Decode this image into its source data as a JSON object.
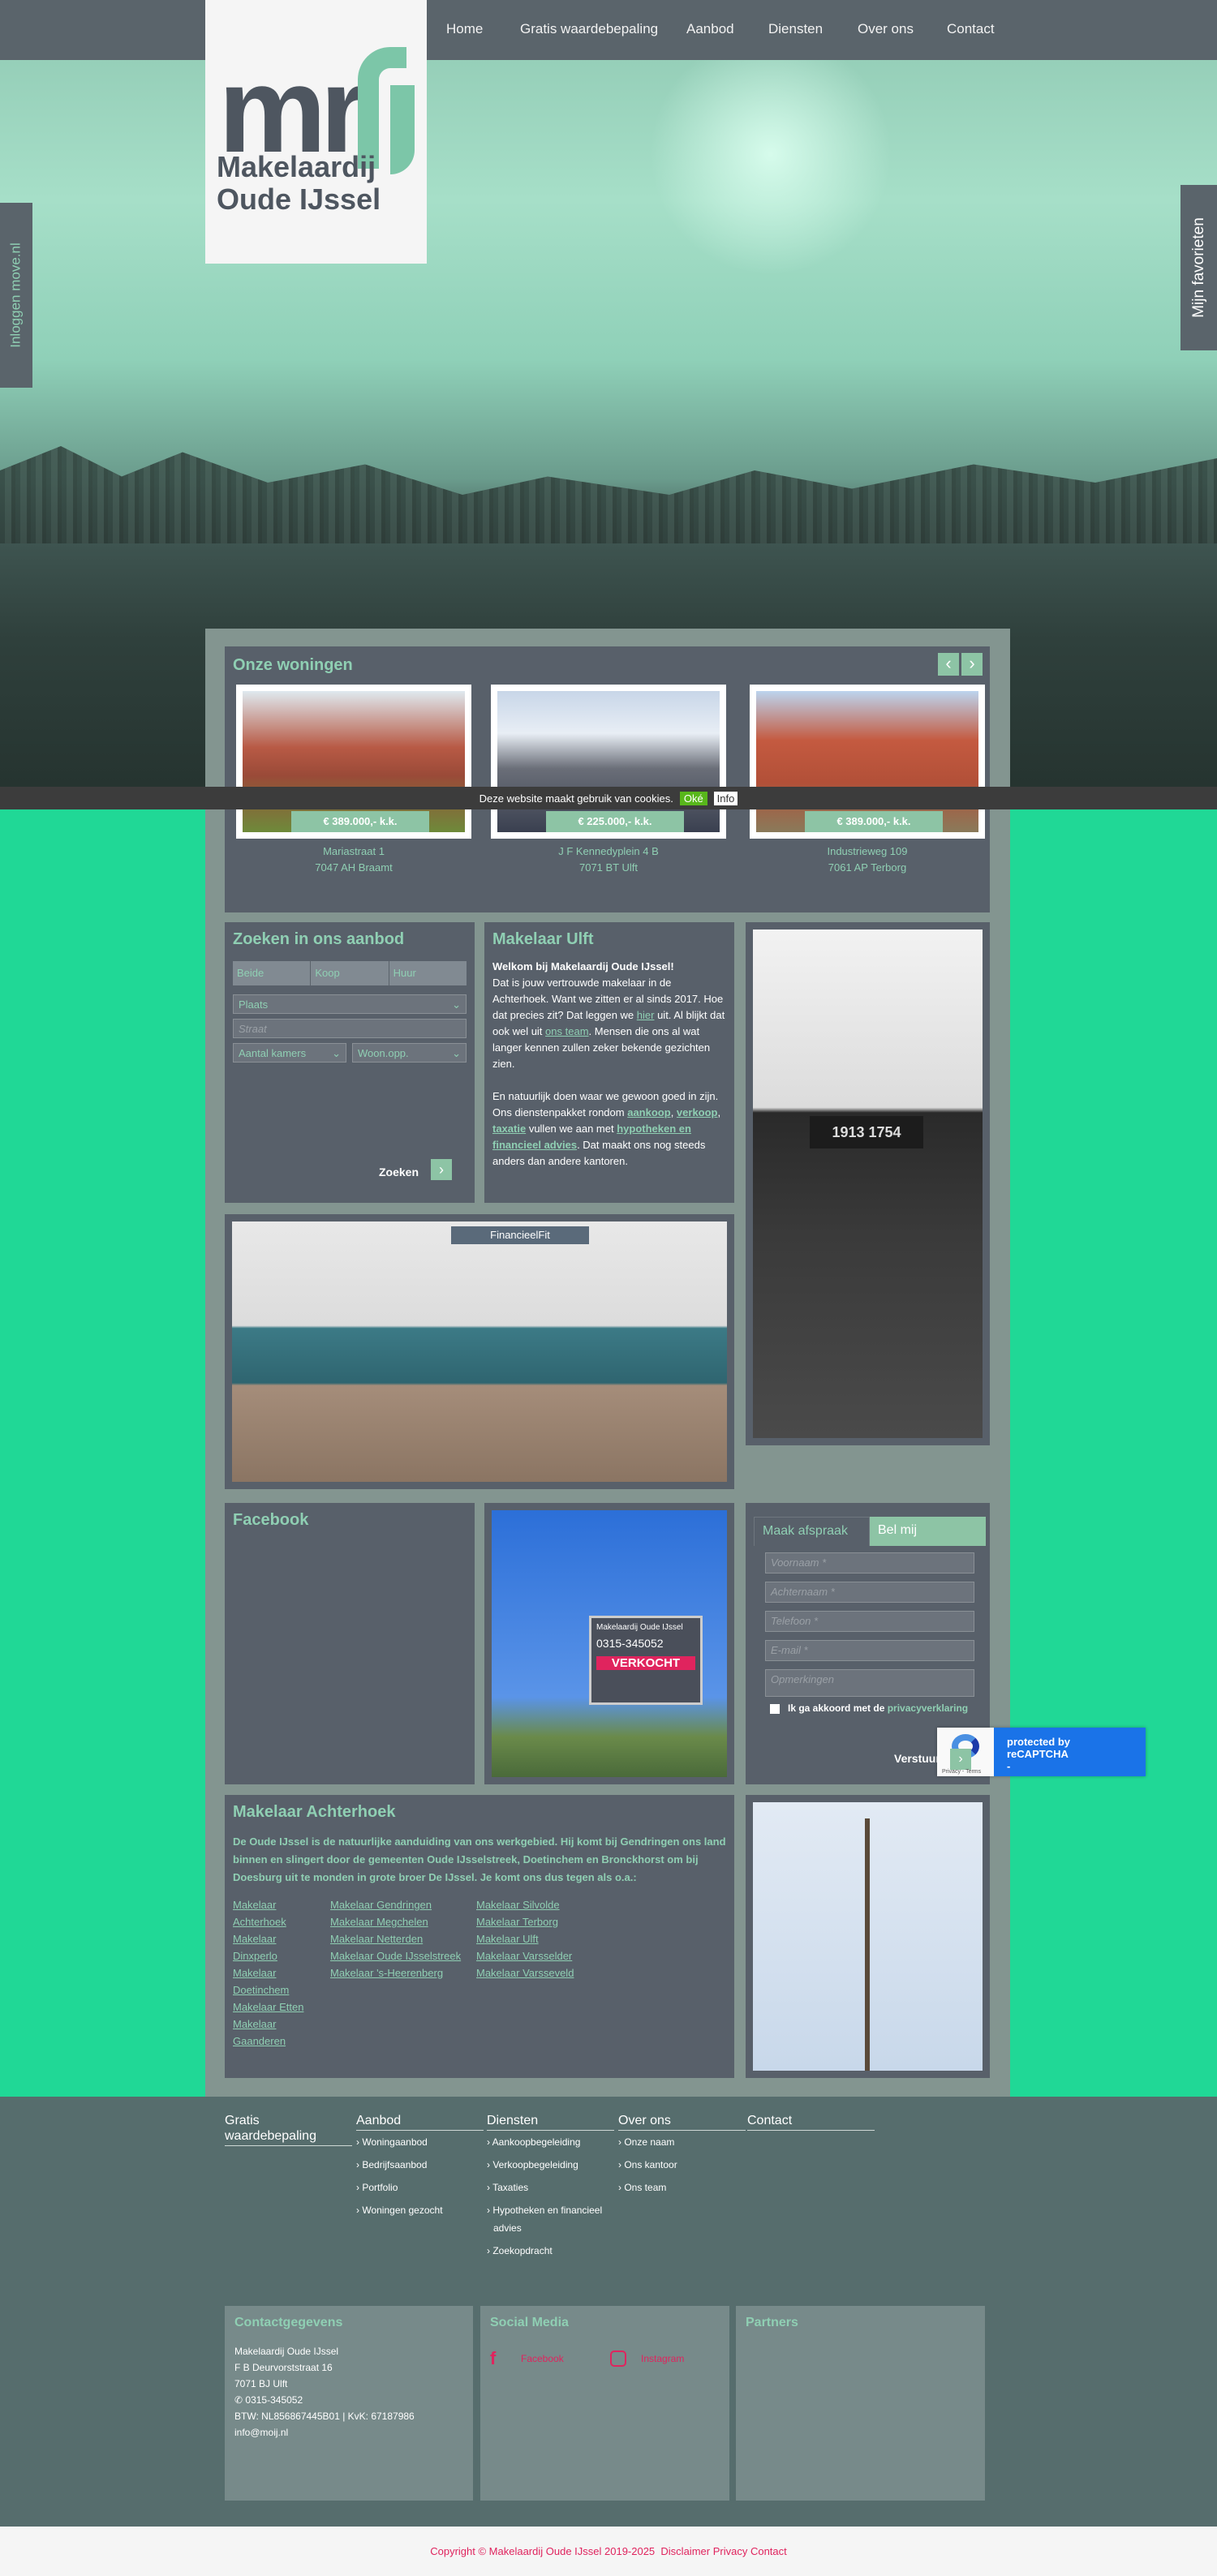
{
  "nav": {
    "items": [
      "Home",
      "Gratis waardebepaling",
      "Aanbod",
      "Diensten",
      "Over ons",
      "Contact"
    ]
  },
  "logo": {
    "mark": "mr",
    "line1": "Makelaardij",
    "line2": "Oude IJssel"
  },
  "side_tabs": {
    "left": "Inloggen move.nl",
    "right": "Mijn favorieten"
  },
  "cookie": {
    "text": "Deze website maakt gebruik van cookies.",
    "ok": "Oké",
    "info": "Info"
  },
  "woningen": {
    "title": "Onze woningen",
    "prev": "‹",
    "next": "›",
    "items": [
      {
        "price": "€ 389.000,- k.k.",
        "street": "Mariastraat 1",
        "city": "7047 AH Braamt"
      },
      {
        "price": "€ 225.000,- k.k.",
        "street": "J F Kennedyplein 4 B",
        "city": "7071 BT Ulft"
      },
      {
        "price": "€ 389.000,- k.k.",
        "street": "Industrieweg 109",
        "city": "7061 AP Terborg"
      }
    ]
  },
  "search": {
    "title": "Zoeken in ons aanbod",
    "tabs": [
      "Beide",
      "Koop",
      "Huur"
    ],
    "plaats": "Plaats",
    "straat_placeholder": "Straat",
    "kamers": "Aantal kamers",
    "opp": "Woon.opp.",
    "submit": "Zoeken"
  },
  "ulft": {
    "title": "Makelaar Ulft",
    "welcome": "Welkom bij Makelaardij Oude IJssel!",
    "p1a": "Dat is jouw vertrouwde makelaar in de Achterhoek. Want we zitten er al sinds 2017. Hoe dat precies zit? Dat leggen we ",
    "hier": "hier",
    "p1b": " uit. Al blijkt dat ook wel uit ",
    "team": "ons team",
    "p1c": ". Mensen die ons al wat langer kennen zullen zeker bekende gezichten zien.",
    "p2a": "En natuurlijk doen waar we gewoon goed in zijn. Ons dienstenpakket rondom ",
    "aankoop": "aankoop",
    "verkoop": "verkoop",
    "taxatie": "taxatie",
    "p2b": " vullen we aan met ",
    "hypo": "hypotheken en financieel advies",
    "p2c": ". Dat maakt ons nog steeds anders dan andere kantoren.",
    "comma": ", "
  },
  "images": {
    "tower_text": "1913 1754",
    "office_sign": "FinancieelFit",
    "sign_brand": "Makelaardij Oude IJssel",
    "sign_phone": "0315-345052",
    "sign_sold": "VERKOCHT"
  },
  "facebook": {
    "title": "Facebook"
  },
  "form": {
    "tab_active": "Maak afspraak",
    "tab_other": "Bel mij",
    "fields": [
      "Voornaam *",
      "Achternaam *",
      "Telefoon *",
      "E-mail *",
      "Opmerkingen"
    ],
    "consent": "Ik ga akkoord met de ",
    "privacy": "privacyverklaring",
    "submit": "Verstuur"
  },
  "recaptcha": {
    "text": "protected by reCAPTCHA",
    "sub": "-",
    "privacy": "Privacy",
    "terms": "Terms"
  },
  "achterhoek": {
    "title": "Makelaar Achterhoek",
    "text": "De Oude IJssel is de natuurlijke aanduiding van ons werkgebied. Hij komt bij Gendringen ons land binnen en slingert door de gemeenten Oude IJsselstreek, Doetinchem en Bronckhorst om bij Doesburg uit te monden in grote broer De IJssel. Je komt ons dus tegen als o.a.:",
    "col1": [
      "Makelaar Achterhoek",
      "Makelaar Dinxperlo",
      "Makelaar Doetinchem",
      "Makelaar Etten",
      "Makelaar Gaanderen"
    ],
    "col2": [
      "Makelaar Gendringen",
      "Makelaar Megchelen",
      "Makelaar Netterden",
      "Makelaar Oude IJsselstreek",
      "Makelaar 's-Heerenberg"
    ],
    "col3": [
      "Makelaar Silvolde",
      "Makelaar Terborg",
      "Makelaar Ulft",
      "Makelaar Varsselder",
      "Makelaar Varsseveld"
    ]
  },
  "footer": {
    "cols": [
      {
        "title": "Gratis waardebepaling",
        "items": []
      },
      {
        "title": "Aanbod",
        "items": [
          "Woningaanbod",
          "Bedrijfsaanbod",
          "Portfolio",
          "Woningen gezocht"
        ]
      },
      {
        "title": "Diensten",
        "items": [
          "Aankoopbegeleiding",
          "Verkoopbegeleiding",
          "Taxaties",
          "Hypotheken en financieel advies",
          "Zoekopdracht"
        ]
      },
      {
        "title": "Over ons",
        "items": [
          "Onze naam",
          "Ons kantoor",
          "Ons team"
        ]
      },
      {
        "title": "Contact",
        "items": []
      }
    ],
    "contact": {
      "title": "Contactgegevens",
      "lines": [
        "Makelaardij Oude IJssel",
        "F B Deurvorststraat 16",
        "7071 BJ Ulft"
      ],
      "phone": "0315-345052",
      "btw": "BTW: NL856867445B01 | KvK: 67187986",
      "email": "info@moij.nl"
    },
    "social": {
      "title": "Social Media",
      "facebook": "Facebook",
      "instagram": "Instagram"
    },
    "partners": {
      "title": "Partners"
    },
    "copyright": "Copyright © Makelaardij Oude IJssel 2019-2025",
    "links": [
      "Disclaimer",
      "Privacy",
      "Contact"
    ]
  },
  "colors": {
    "accent": "#8fcfb3",
    "panel": "#58606a",
    "bg_green": "#20d896",
    "pink": "#e0245e"
  }
}
